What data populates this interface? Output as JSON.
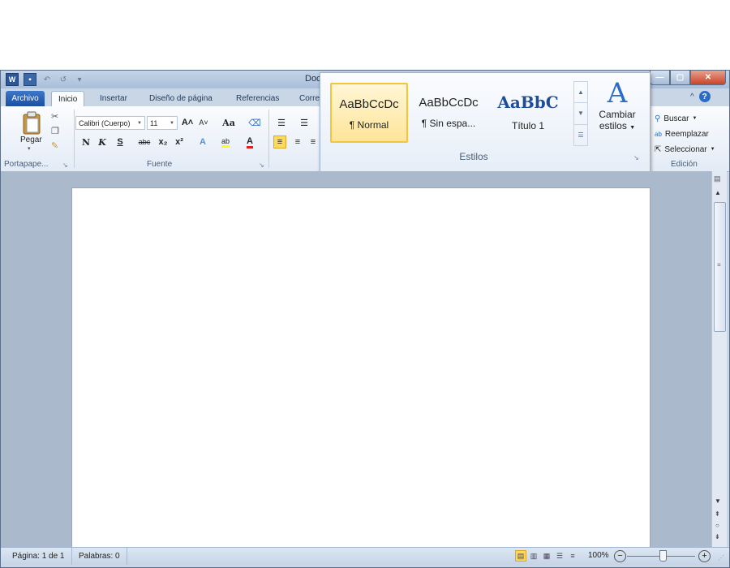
{
  "window": {
    "title_partial": "Doc"
  },
  "qat": {
    "app_icon": "word-icon",
    "app_icon_letter": "W",
    "undo_glyph": "↶",
    "redo_glyph": "↺",
    "customize_glyph": "▾"
  },
  "window_controls": {
    "minimize": "—",
    "maximize": "▢",
    "close": "✕"
  },
  "tabs": {
    "file": "Archivo",
    "items": [
      "Inicio",
      "Insertar",
      "Diseño de página",
      "Referencias",
      "Corre"
    ]
  },
  "help": {
    "collapse": "^",
    "help": "?"
  },
  "clipboard": {
    "paste_label": "Pegar",
    "group_label": "Portapape...",
    "paste_arrow": "▾"
  },
  "font": {
    "font_name": "Calibri (Cuerpo)",
    "font_size": "11",
    "grow": "A˄",
    "shrink": "A˅",
    "change_case": "Aa",
    "bold": "N",
    "italic": "K",
    "underline": "S",
    "strikethrough": "abc",
    "subscript": "x₂",
    "superscript": "x²",
    "group_label": "Fuente"
  },
  "styles": {
    "items": [
      {
        "sample": "AaBbCcDc",
        "name": "¶ Normal"
      },
      {
        "sample": "AaBbCcDc",
        "name": "¶ Sin espa..."
      },
      {
        "sample": "AaBbC",
        "name": "Título 1"
      }
    ],
    "change_styles_label": "Cambiar",
    "change_styles_label2": "estilos",
    "group_label": "Estilos"
  },
  "editing": {
    "find": "Buscar",
    "replace": "Reemplazar",
    "select": "Seleccionar",
    "group_label": "Edición"
  },
  "status": {
    "page": "Página: 1 de 1",
    "words": "Palabras: 0",
    "zoom": "100%",
    "zoom_out": "−",
    "zoom_in": "+"
  },
  "colors": {
    "accent": "#2b579a",
    "ribbon_bg": "#e2ebf6",
    "doc_bg": "#abb9cc",
    "selected_style": "#ffe59a"
  }
}
